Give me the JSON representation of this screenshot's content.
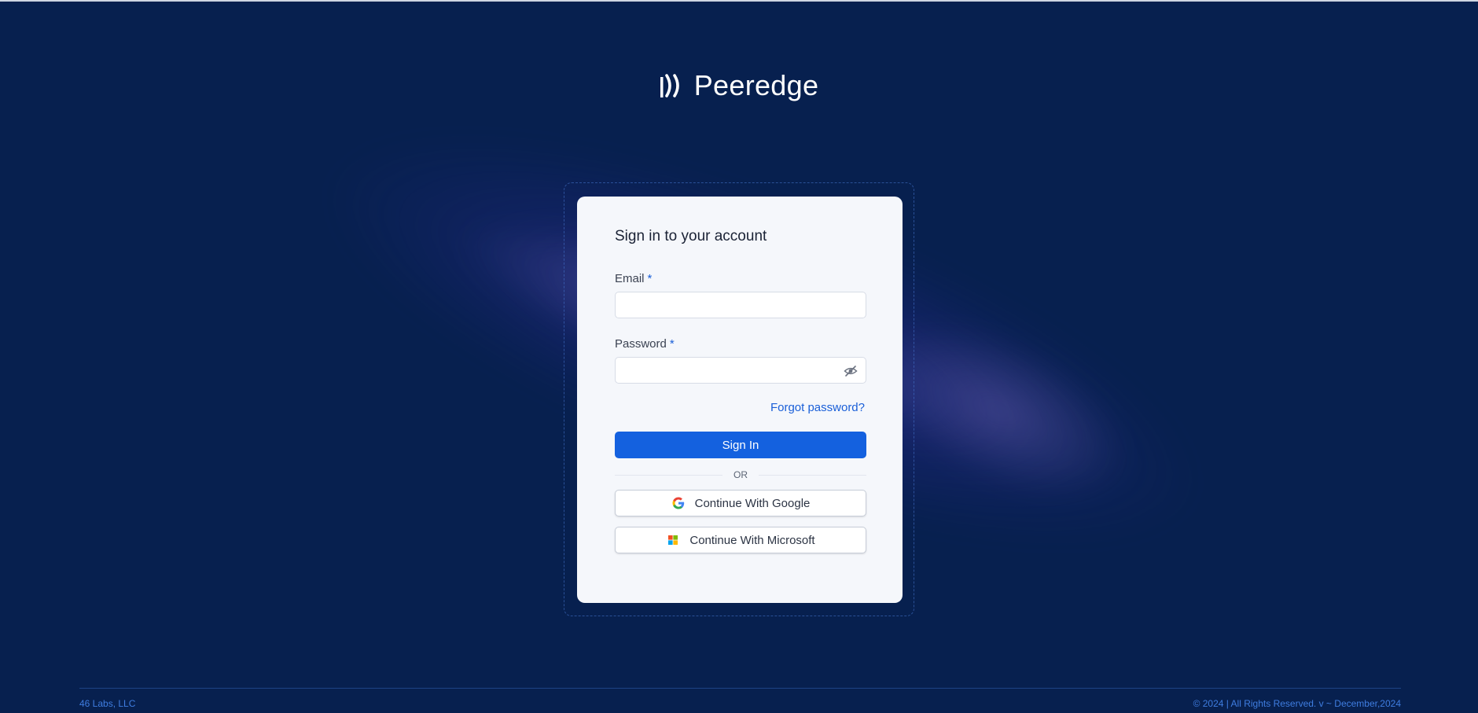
{
  "brand": {
    "name": "Peeredge",
    "logo_icon": "peeredge-logo-icon"
  },
  "login": {
    "title": "Sign in to your account",
    "email_label": "Email",
    "password_label": "Password",
    "required_mark": "*",
    "email_value": "",
    "password_value": "",
    "forgot_link": "Forgot password?",
    "sign_in_button": "Sign In",
    "divider": "OR",
    "google_button": "Continue With Google",
    "microsoft_button": "Continue With Microsoft"
  },
  "footer": {
    "company": "46 Labs, LLC",
    "copyright": "© 2024 | All Rights Reserved. v ~ December,2024"
  },
  "colors": {
    "background": "#07204f",
    "primary": "#1461df",
    "link": "#1a5fd8",
    "footer_text": "#3f7de0"
  }
}
